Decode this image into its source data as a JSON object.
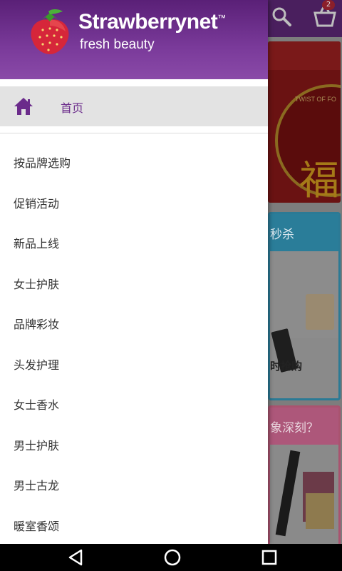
{
  "app": {
    "brand_name": "Strawberrynet",
    "trademark": "™",
    "tagline": "fresh beauty"
  },
  "drawer": {
    "home_label": "首页",
    "items": [
      {
        "label": "按品牌选购"
      },
      {
        "label": "促销活动"
      },
      {
        "label": "新品上线"
      },
      {
        "label": "女士护肤"
      },
      {
        "label": "品牌彩妆"
      },
      {
        "label": "头发护理"
      },
      {
        "label": "女士香水"
      },
      {
        "label": "男士护肤"
      },
      {
        "label": "男士古龙"
      },
      {
        "label": "暖室香颂"
      }
    ]
  },
  "background": {
    "cart_badge": "2",
    "banner_text": "TWIST OF FO",
    "banner_glyph": "福",
    "card1_header": "秒杀",
    "card1_text": "时抢购",
    "card2_header": "象深刻？"
  },
  "colors": {
    "brand_purple": "#7a3a9a",
    "home_label": "#6b2b8b"
  },
  "icons": {
    "home": "home-icon",
    "search": "search-icon",
    "cart": "cart-icon",
    "back": "back-icon",
    "home_nav": "home-nav-icon",
    "recents": "recents-icon"
  }
}
